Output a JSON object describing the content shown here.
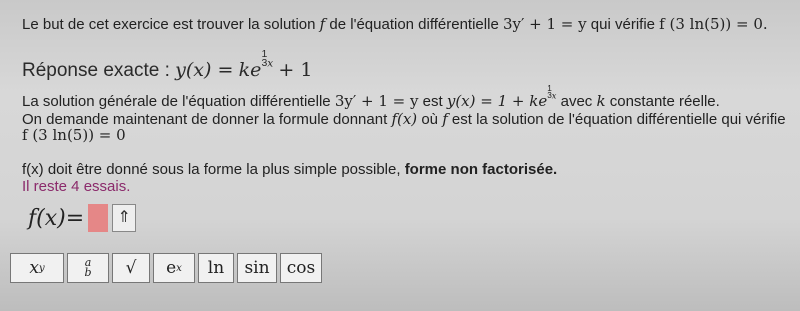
{
  "intro": {
    "text": "Le but de cet exercice est trouver la solution",
    "f": "f",
    "mid": "de l'équation différentielle",
    "equation": "3y′ + 1 = y",
    "check_text": "qui vérifie",
    "condition": "f (3 ln(5)) = 0."
  },
  "expected": {
    "label": "Réponse exacte :",
    "lhs": "y(x) =",
    "k": "ke",
    "exp_num": "1",
    "exp_den": "3",
    "exp_x": "x",
    "tail": "+ 1"
  },
  "general": {
    "text": "La solution générale de l'équation différentielle",
    "equation": "3y′ + 1 = y",
    "est": "est",
    "solution": "y(x) = 1 + ke",
    "exp_num": "1",
    "exp_den": "3",
    "exp_x": "x",
    "avec": "avec",
    "k": "k",
    "const": "constante réelle."
  },
  "request": {
    "text": "On demande maintenant de donner la formule donnant",
    "fx": "f(x)",
    "ou": "où",
    "f": "f",
    "rest": "est la solution de l'équation différentielle qui vérifie",
    "condition": "f (3 ln(5)) = 0"
  },
  "form": {
    "text": "f(x) doit être donné sous la forme la plus simple possible,",
    "bold": "forme non factorisée."
  },
  "attempts": "Il reste 4 essais.",
  "answer": {
    "label": "f(x)=",
    "arrow": "⇑"
  },
  "toolbar": {
    "power_base": "x",
    "power_exp": "y",
    "frac_num": "a",
    "frac_den": "b",
    "sqrt": "√",
    "exp_base": "e",
    "exp_exp": "x",
    "ln": "ln",
    "sin": "sin",
    "cos": "cos"
  }
}
